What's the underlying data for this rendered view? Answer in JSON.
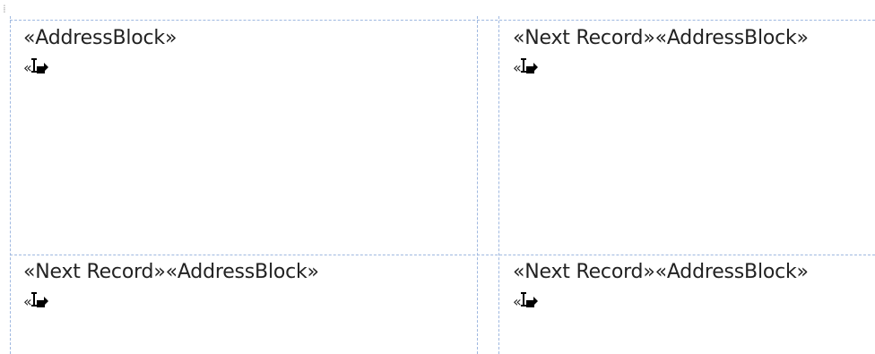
{
  "cells": [
    {
      "fields": [
        "«AddressBlock»"
      ],
      "sub_prefix": "«",
      "sub_icon": "insert-field-icon"
    },
    {
      "fields": [
        "«Next Record»",
        "«AddressBlock»"
      ],
      "sub_prefix": "«",
      "sub_icon": "insert-field-icon"
    },
    {
      "fields": [
        "«Next Record»",
        "«AddressBlock»"
      ],
      "sub_prefix": "«",
      "sub_icon": "insert-field-icon"
    },
    {
      "fields": [
        "«Next Record»",
        "«AddressBlock»"
      ],
      "sub_prefix": "«",
      "sub_icon": "insert-field-icon"
    }
  ],
  "gridline_color": "#9fb8e0",
  "text_color": "#222222"
}
